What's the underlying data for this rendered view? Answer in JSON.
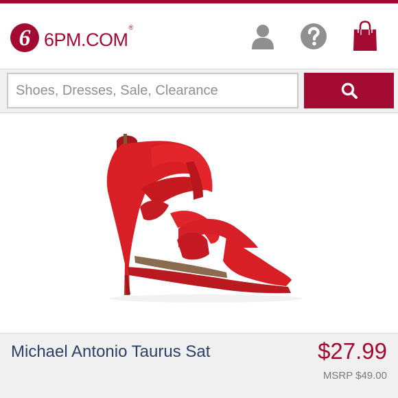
{
  "header": {
    "brand": "6PM.COM",
    "trademark": "®",
    "logo_icon": "6pm-logo-icon",
    "account_icon": "user-icon",
    "help_icon": "question-icon",
    "bag_icon": "shopping-bag-icon"
  },
  "search": {
    "placeholder": "Shoes, Dresses, Sale, Clearance",
    "value": "",
    "button_icon": "search-icon"
  },
  "product": {
    "image_alt": "red satin strappy high heel sandal",
    "name": "Michael Antonio Taurus Sat",
    "price": "$27.99",
    "msrp": "MSRP $49.00"
  },
  "colors": {
    "brand": "#a30a32",
    "icon_gray": "#8f8f8f",
    "product_name": "#2c4066",
    "shoe_red": "#d81f26"
  }
}
